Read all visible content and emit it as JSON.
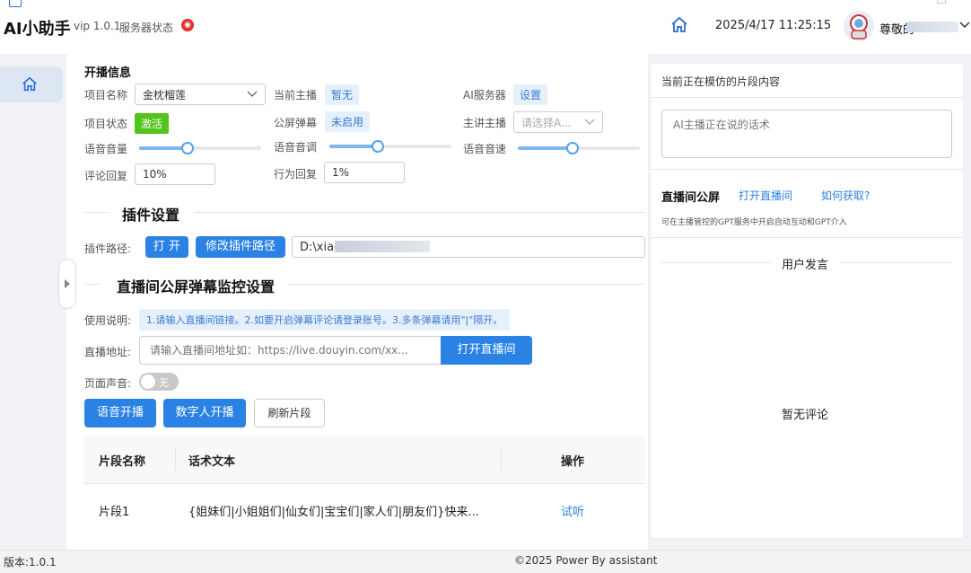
{
  "header": {
    "title": "AI小助手",
    "version": "vip 1.0.1",
    "server_status": "服务器状态",
    "datetime": "2025/4/17 11:25:15",
    "user_name": "尊敬的 "
  },
  "broadcast": {
    "section_title": "开播信息",
    "project_name_label": "项目名称",
    "project_name_value": "金枕榴莲",
    "anchor_label": "当前主播",
    "anchor_value": "暂无",
    "ai_server_label": "AI服务器",
    "ai_server_value": "设置",
    "project_status_label": "项目状态",
    "project_status_value": "激活",
    "public_barrage_label": "公屏弹幕",
    "public_barrage_value": "未启用",
    "main_anchor_label": "主讲主播",
    "main_anchor_placeholder": "请选择A...",
    "volume_label": "语音音量",
    "volume_level": 0.4,
    "tone_label": "语音音调",
    "tone_level": 0.4,
    "speed_label": "语音音速",
    "speed_level": 0.45,
    "comment_reply_label": "评论回复",
    "comment_reply_value": "10%",
    "action_reply_label": "行为回复",
    "action_reply_value": "1%"
  },
  "plugin": {
    "section_title": "插件设置",
    "path_label": "插件路径:",
    "open_btn": "打 开",
    "modify_btn": "修改插件路径",
    "path_value": "D:\\xiao"
  },
  "monitor": {
    "section_title": "直播间公屏弹幕监控设置",
    "usage_label": "使用说明:",
    "usage_text": "1.请输入直播间链接。2.如要开启弹幕评论请登录账号。3.多条弹幕请用\"|\"隔开。",
    "url_label": "直播地址:",
    "url_placeholder": "请输入直播间地址如：https://live.douyin.com/xx...",
    "open_live_btn": "打开直播间",
    "page_sound_label": "页面声音:",
    "page_sound_value": "无"
  },
  "actions": {
    "voice_btn": "语音开播",
    "digital_btn": "数字人开播",
    "refresh_btn": "刷新片段"
  },
  "table": {
    "col_name": "片段名称",
    "col_text": "话术文本",
    "col_action": "操作",
    "rows": [
      {
        "name": "片段1",
        "text": "{姐妹们|小姐姐们|仙女们|宝宝们|家人们|朋友们}快来...",
        "action": "试听"
      }
    ]
  },
  "right": {
    "imitating_title": "当前正在模仿的片段内容",
    "ai_placeholder": "AI主播正在说的话术",
    "public_title": "直播间公屏",
    "open_live_link": "打开直播间",
    "how_link": "如何获取?",
    "desc": "可在主播管控的GPT服务中开启自动互动和GPT介入",
    "user_speech": "用户发言",
    "no_comment": "暂无评论"
  },
  "footer": {
    "version": "版本:1.0.1",
    "copyright": "©2025 Power By assistant"
  },
  "colors": {
    "primary": "#2a82e4",
    "active_green": "#52c41a",
    "tag_bg": "#e6f0fb"
  }
}
